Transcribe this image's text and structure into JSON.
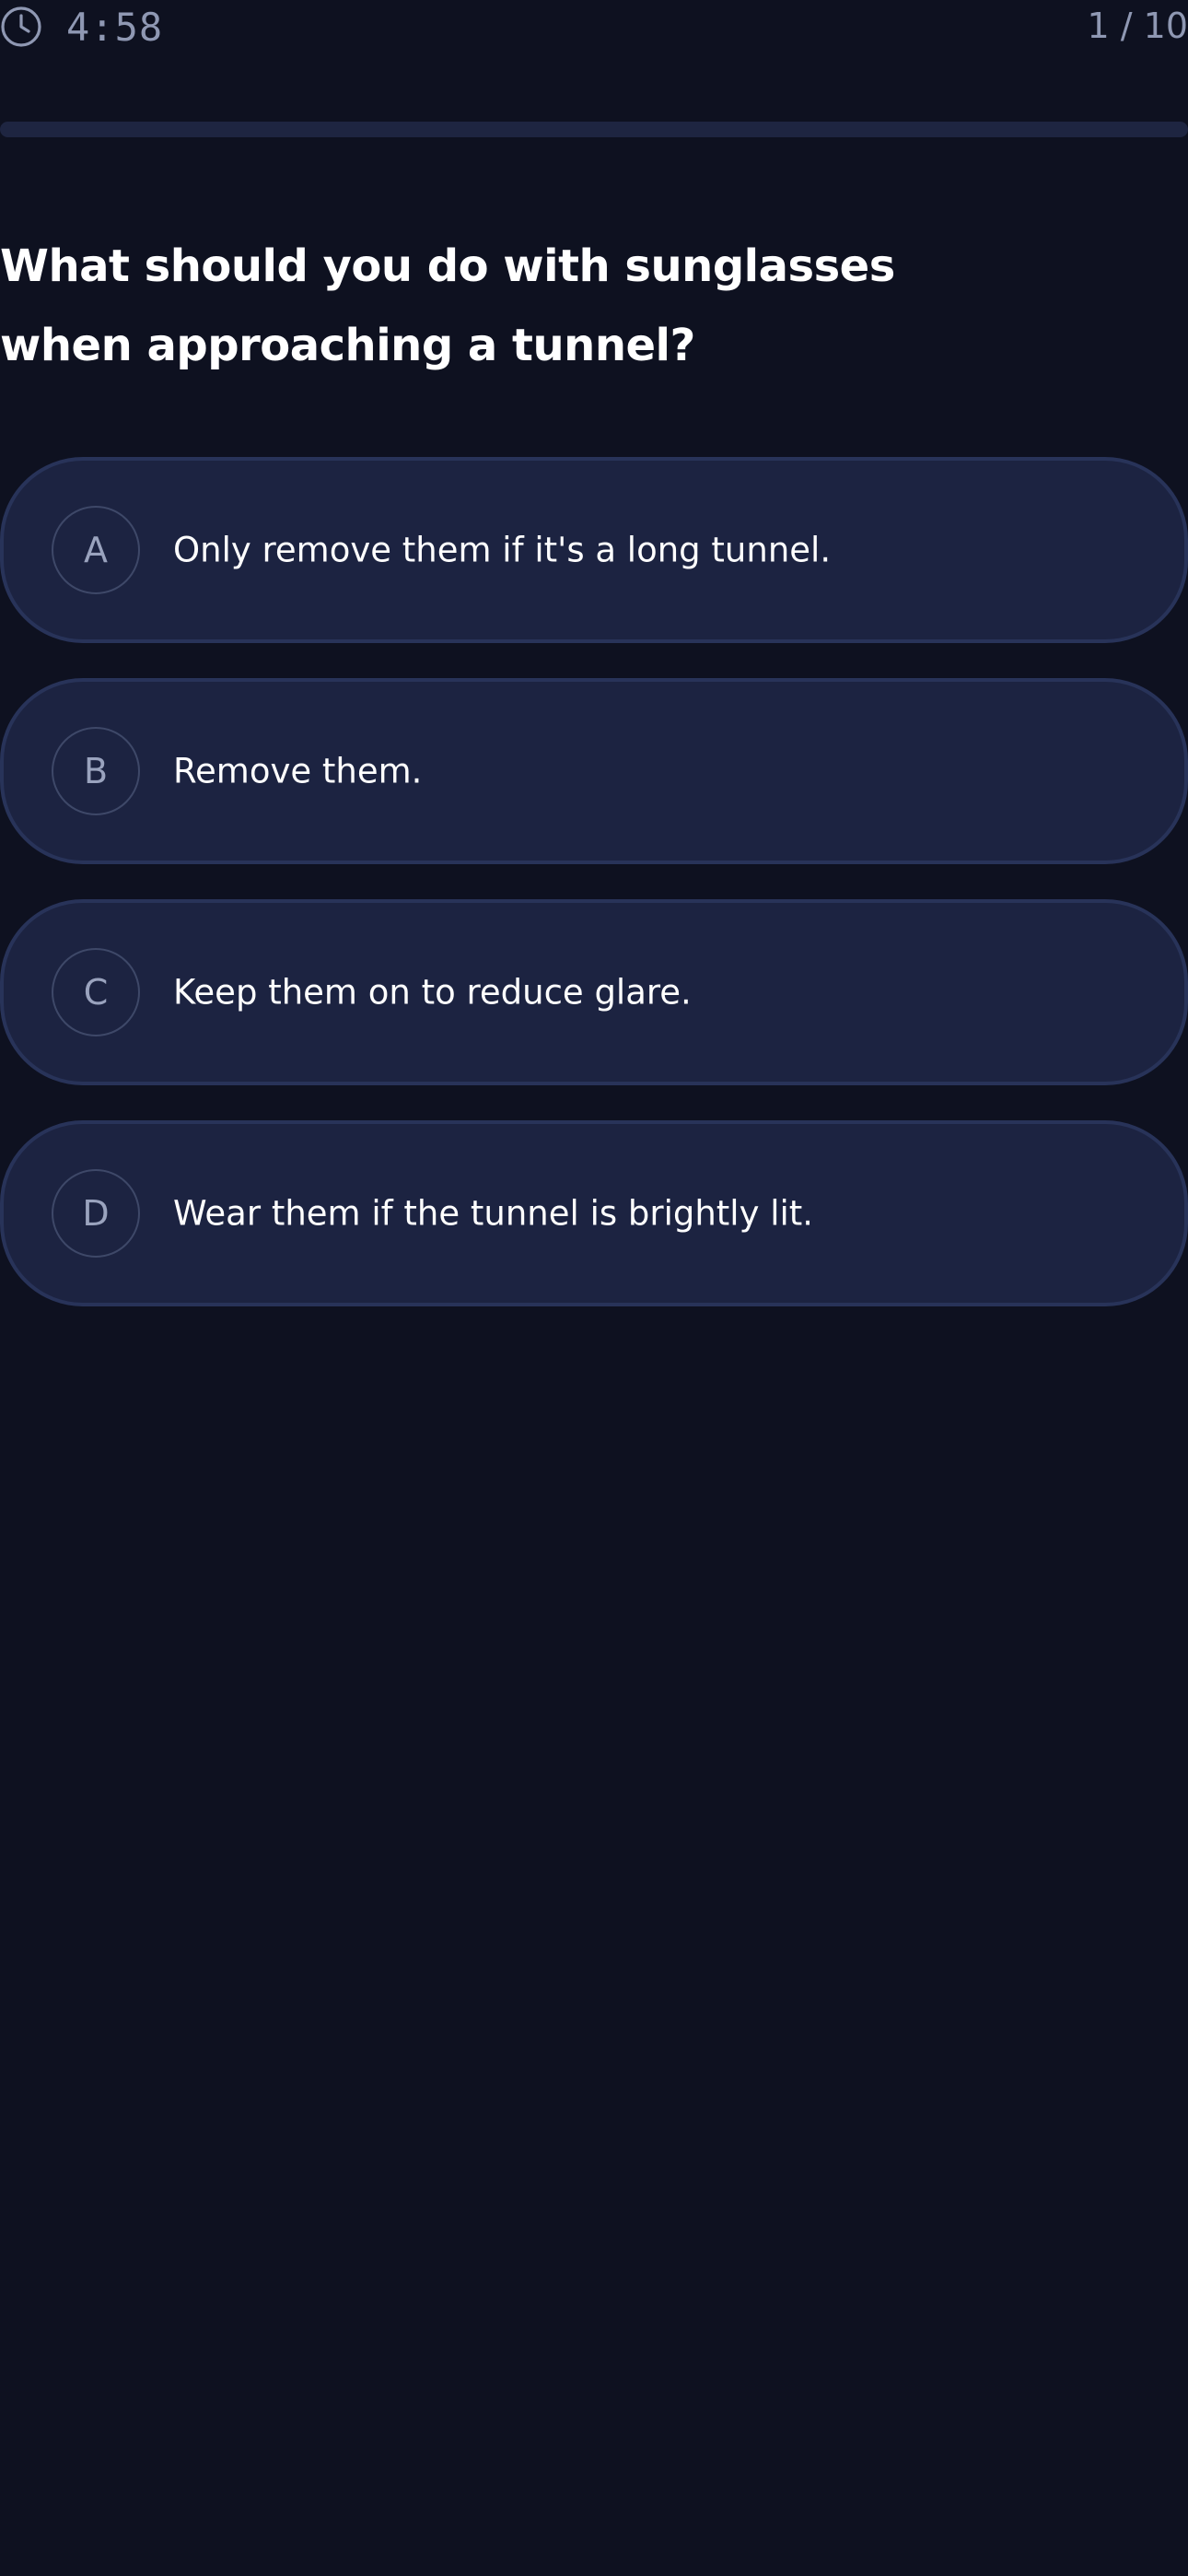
{
  "header": {
    "timer": "4:58",
    "counter": "1 / 10",
    "clock_icon": "clock-icon"
  },
  "progress": {
    "fraction": 0.0
  },
  "question": {
    "text": "What should you do with sunglasses when approaching a tunnel?"
  },
  "options": [
    {
      "letter": "A",
      "text": "Only remove them if it's a long tunnel."
    },
    {
      "letter": "B",
      "text": "Remove them."
    },
    {
      "letter": "C",
      "text": "Keep them on to reduce glare."
    },
    {
      "letter": "D",
      "text": "Wear them if the tunnel is brightly lit."
    }
  ],
  "colors": {
    "background": "#0e1120",
    "option_bg": "#1c2341",
    "option_border": "#283359",
    "muted_text": "#8f98b3",
    "progress_track": "#1e2541"
  }
}
